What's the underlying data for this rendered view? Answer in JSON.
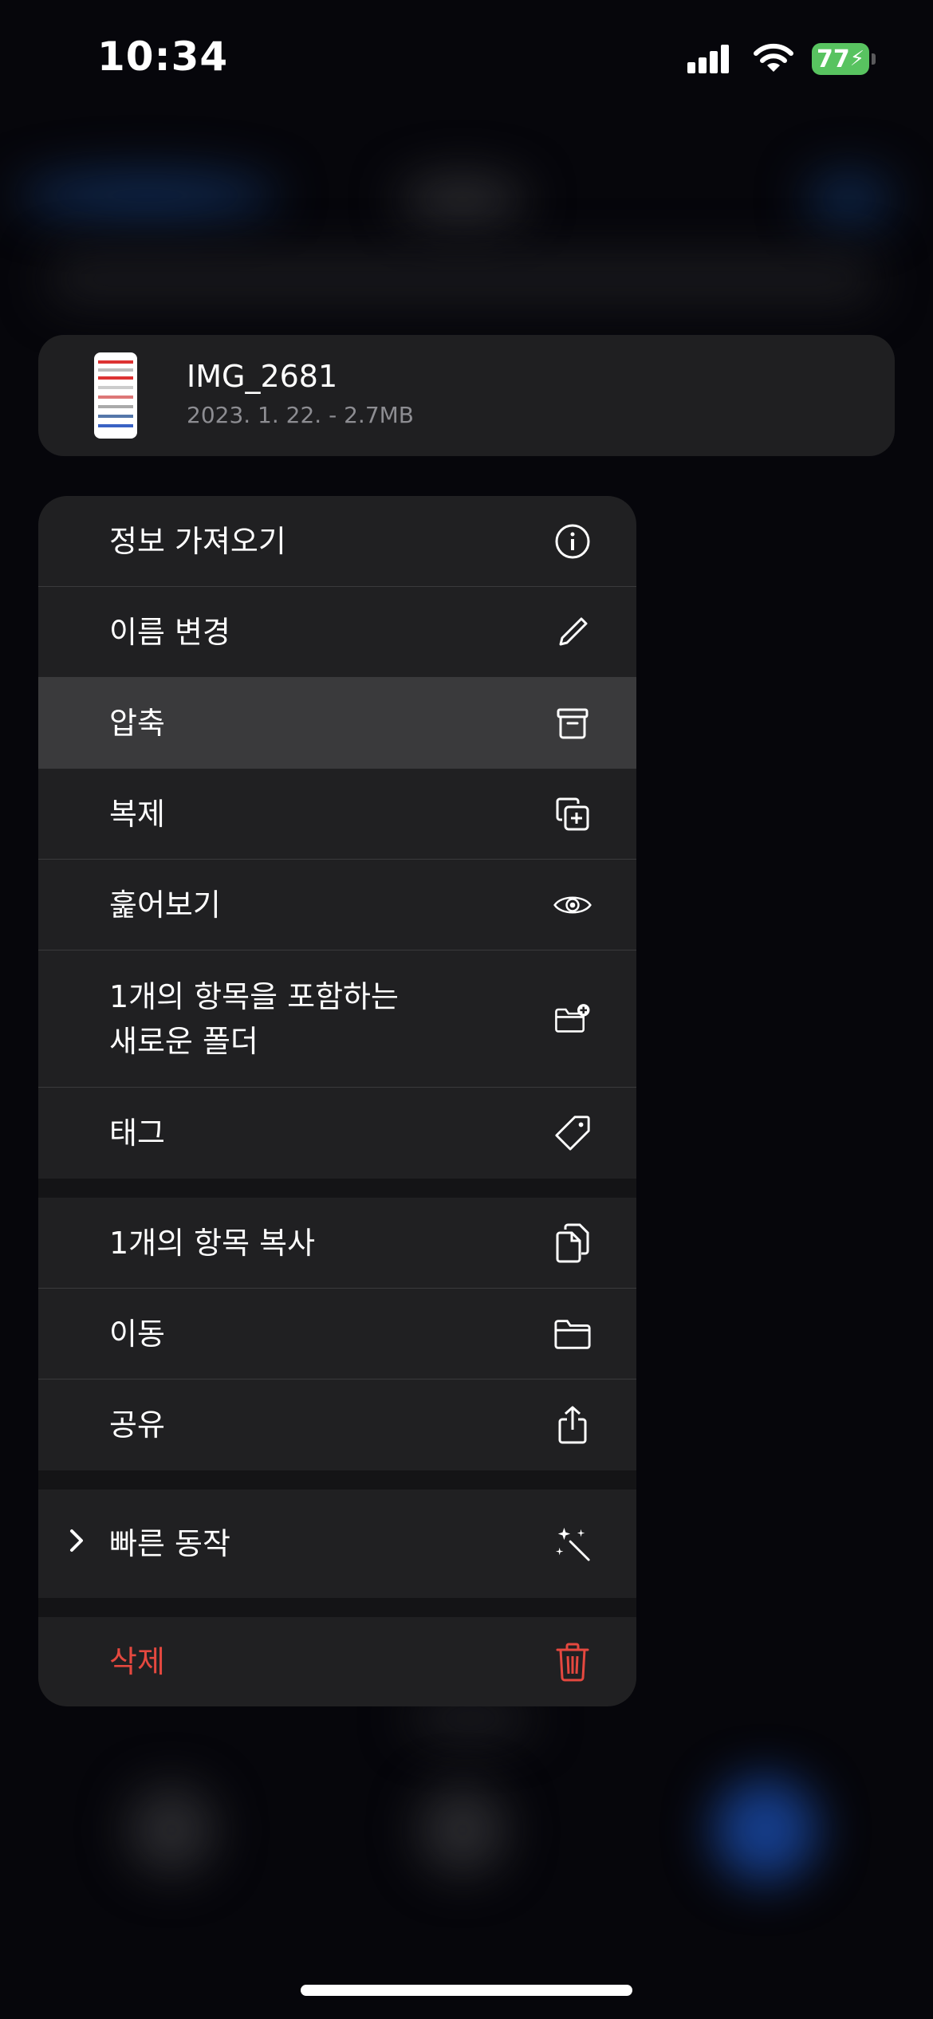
{
  "status_bar": {
    "time": "10:34",
    "battery": "77"
  },
  "file": {
    "name": "IMG_2681",
    "meta": "2023. 1. 22. - 2.7MB"
  },
  "menu": {
    "group1": [
      {
        "label": "정보 가져오기",
        "icon": "info-circle-icon"
      },
      {
        "label": "이름 변경",
        "icon": "pencil-icon"
      },
      {
        "label": "압축",
        "icon": "archive-box-icon",
        "highlighted": true
      },
      {
        "label": "복제",
        "icon": "duplicate-plus-icon"
      },
      {
        "label": "훑어보기",
        "icon": "eye-icon"
      },
      {
        "label": "1개의 항목을 포함하는\n새로운 폴더",
        "icon": "folder-plus-icon"
      },
      {
        "label": "태그",
        "icon": "tag-icon"
      }
    ],
    "group2": [
      {
        "label": "1개의 항목 복사",
        "icon": "copy-doc-icon"
      },
      {
        "label": "이동",
        "icon": "folder-icon"
      },
      {
        "label": "공유",
        "icon": "share-icon"
      }
    ],
    "group3": [
      {
        "label": "빠른 동작",
        "icon": "magic-wand-icon",
        "expandable": true
      }
    ],
    "group4": [
      {
        "label": "삭제",
        "icon": "trash-icon",
        "destructive": true,
        "color": "#e5483f"
      }
    ]
  }
}
